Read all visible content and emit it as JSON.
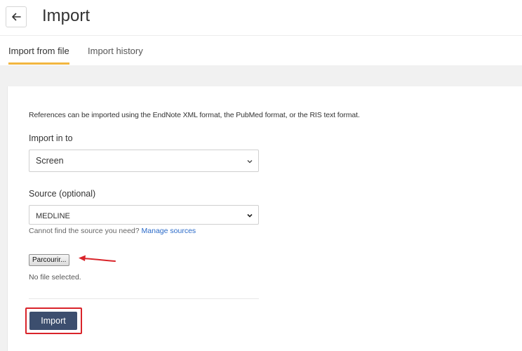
{
  "header": {
    "title": "Import",
    "back_icon": "arrow-left-icon"
  },
  "tabs": [
    {
      "label": "Import from file",
      "active": true
    },
    {
      "label": "Import history",
      "active": false
    }
  ],
  "form": {
    "intro": "References can be imported using the EndNote XML format, the PubMed format, or the RIS text format.",
    "import_in_to": {
      "label": "Import in to",
      "selected": "Screen"
    },
    "source": {
      "label": "Source (optional)",
      "selected": "MEDLINE"
    },
    "help": {
      "text": "Cannot find the source you need?",
      "link": "Manage sources"
    },
    "file": {
      "button_label": "Parcourir...",
      "status": "No file selected."
    },
    "submit_label": "Import"
  },
  "colors": {
    "accent_tab": "#f2b640",
    "primary_button": "#3c4e6e",
    "link": "#2a6ac8",
    "annotation_red": "#d9242a"
  }
}
